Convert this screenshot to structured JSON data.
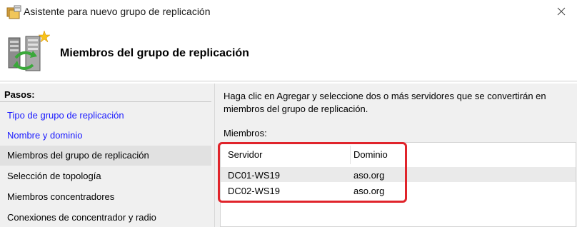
{
  "window": {
    "title": "Asistente para nuevo grupo de replicación",
    "icon": "replication-wizard-icon"
  },
  "header": {
    "title": "Miembros del grupo de replicación",
    "icon": "replication-servers-icon"
  },
  "sidebar": {
    "heading": "Pasos:",
    "items": [
      {
        "label": "Tipo de grupo de replicación",
        "state": "link"
      },
      {
        "label": "Nombre y dominio",
        "state": "link"
      },
      {
        "label": "Miembros del grupo de replicación",
        "state": "active"
      },
      {
        "label": "Selección de topología",
        "state": "normal"
      },
      {
        "label": "Miembros concentradores",
        "state": "normal"
      },
      {
        "label": "Conexiones de concentrador y radio",
        "state": "normal"
      }
    ]
  },
  "main": {
    "description": "Haga clic en Agregar y seleccione dos o más servidores que se convertirán en miembros del grupo de replicación.",
    "members_label": "Miembros:",
    "table": {
      "columns": [
        "Servidor",
        "Dominio"
      ],
      "rows": [
        {
          "server": "DC01-WS19",
          "domain": "aso.org",
          "selected": true
        },
        {
          "server": "DC02-WS19",
          "domain": "aso.org",
          "selected": false
        }
      ]
    }
  },
  "colors": {
    "link": "#1a1aff",
    "highlight_border": "#e0242b",
    "pane_background": "#f0f0f0"
  }
}
